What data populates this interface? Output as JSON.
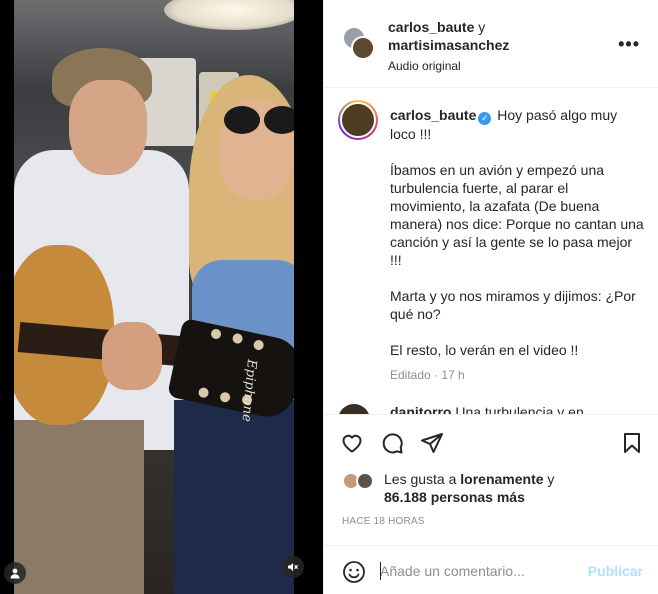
{
  "video": {
    "guitar_brand": "Epiphone",
    "icons": {
      "user_tag": "user-icon",
      "mute": "speaker-muted-icon"
    }
  },
  "header": {
    "author1": "carlos_baute",
    "joiner": "y",
    "author2": "martisimasanchez",
    "audio": "Audio original",
    "more": "•••"
  },
  "caption": {
    "username": "carlos_baute",
    "verified_icon": "verified-badge-icon",
    "intro": "Hoy pasó algo muy loco !!!",
    "p1": "Íbamos en un avión y empezó una turbulencia fuerte, al parar el movimiento, la azafata (De buena manera) nos dice: Porque no cantan una canción y así la gente se lo pasa mejor !!!",
    "p2": "Marta y yo nos miramos y dijimos: ¿Por qué no?",
    "p3": "El resto, lo verán en el video !!",
    "meta": "Editado · 17 h"
  },
  "next_comment": {
    "username": "danitorro",
    "text": "Una turbulencia y en"
  },
  "actions": {
    "icons": [
      "heart-icon",
      "comment-icon",
      "share-icon",
      "bookmark-icon"
    ]
  },
  "likes": {
    "prefix": "Les gusta a",
    "user": "lorenamente",
    "joiner": "y",
    "count": "86.188 personas más"
  },
  "timestamp": "HACE 18 HORAS",
  "comment_box": {
    "placeholder": "Añade un comentario...",
    "post_label": "Publicar"
  },
  "colors": {
    "accent": "#0095f6",
    "post_disabled": "#b2dffc",
    "verified": "#3897f0",
    "muted_text": "#8e8e8e"
  }
}
